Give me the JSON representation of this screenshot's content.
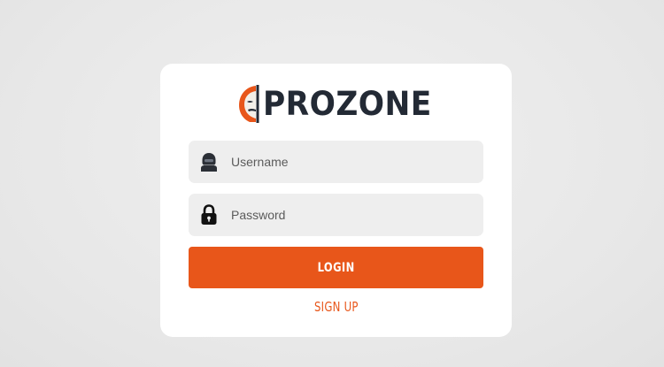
{
  "brand": {
    "name": "PROZONE",
    "logo_icon": "hacker-mask-icon",
    "accent_color": "#e8561a",
    "text_color": "#232a35"
  },
  "form": {
    "username": {
      "placeholder": "Username",
      "value": "",
      "icon": "hooded-user-icon"
    },
    "password": {
      "placeholder": "Password",
      "value": "",
      "icon": "lock-icon"
    },
    "login_label": "LOGIN",
    "signup_label": "SIGN UP"
  }
}
